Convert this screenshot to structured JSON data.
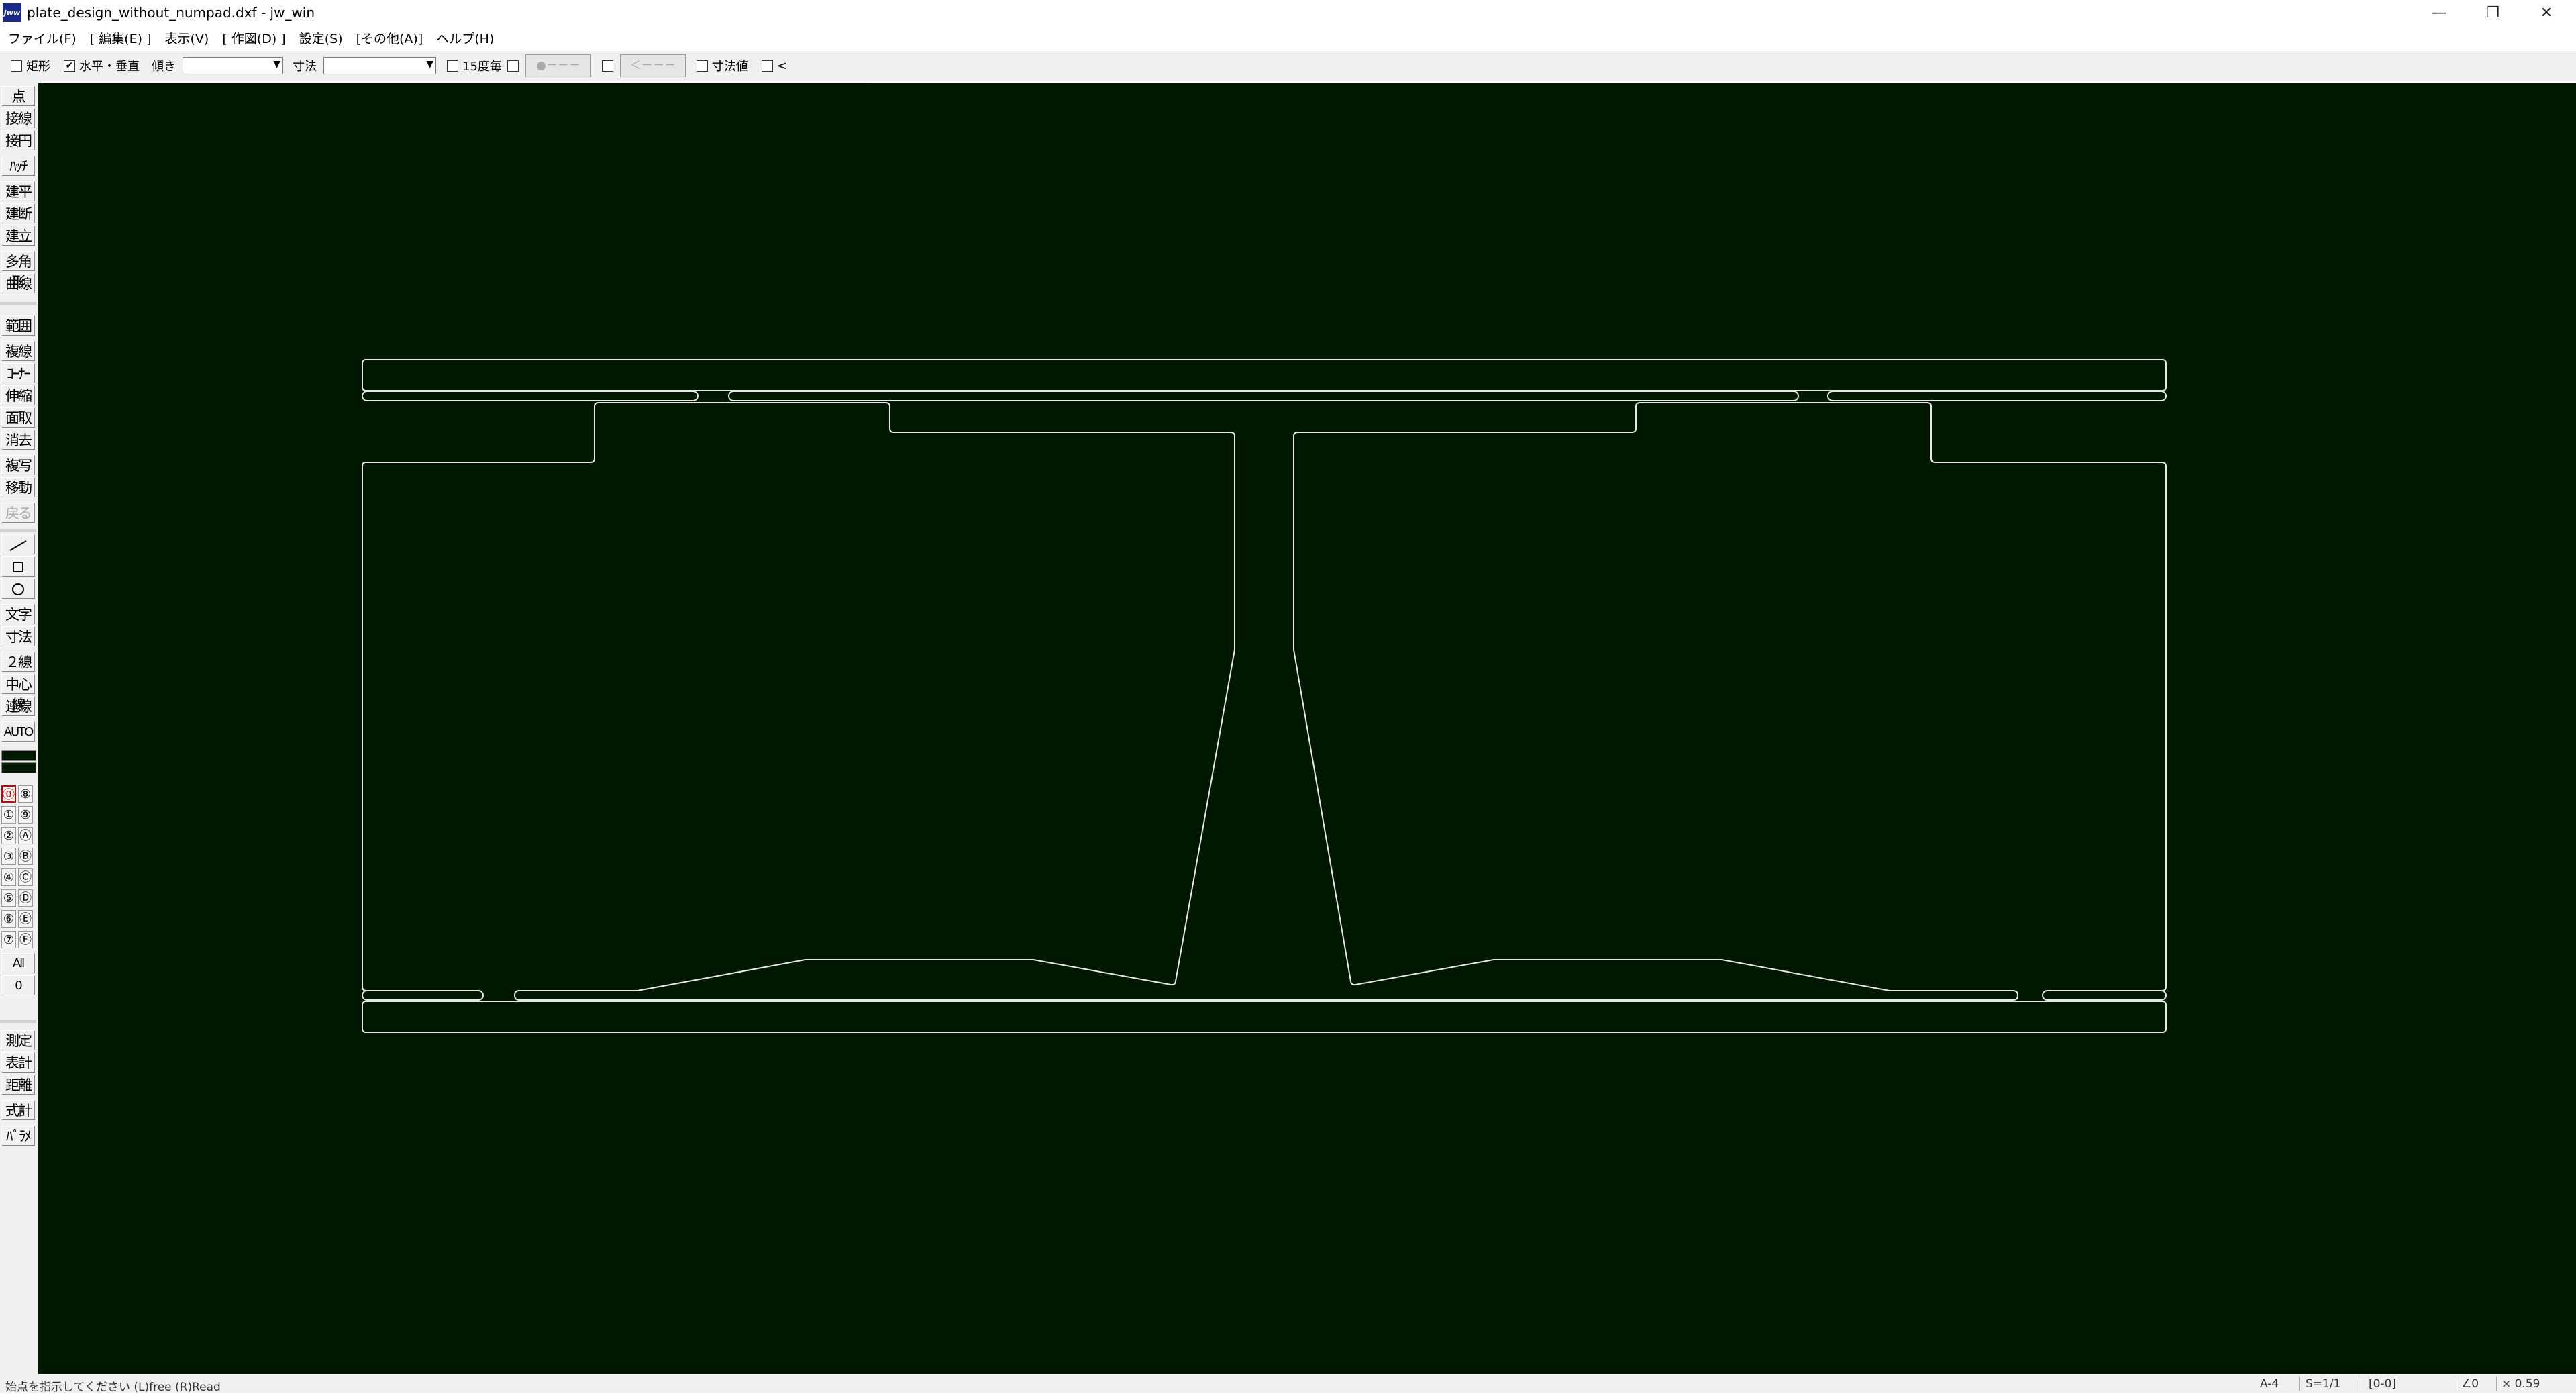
{
  "window": {
    "icon_text": "Jww",
    "title": "plate_design_without_numpad.dxf - jw_win",
    "minimize_label": "—",
    "restore_label": "❐",
    "close_label": "✕"
  },
  "menu": {
    "items": [
      "ファイル(F)",
      "[ 編集(E) ]",
      "表示(V)",
      "[ 作図(D) ]",
      "設定(S)",
      "[その他(A)]",
      "ヘルプ(H)"
    ]
  },
  "options": {
    "rect_label": "矩形",
    "rect_checked": false,
    "hv_label": "水平・垂直",
    "hv_checked": true,
    "tilt_label": "傾き",
    "tilt_value": "",
    "dim_label": "寸法",
    "dim_value": "",
    "deg15_label": "15度毎",
    "deg15_checked": false,
    "btn_dot_label": "●－－－",
    "btn_arrow_label": "＜－－－",
    "dimval_label": "寸法値",
    "dimval_checked": false,
    "lt_label": "<"
  },
  "toolbar": {
    "draw_group1": [
      "点",
      "接線",
      "接円",
      "ﾊｯﾁ",
      "建平",
      "建断",
      "建立",
      "多角形",
      "曲線"
    ],
    "edit_group": [
      "範囲",
      "複線",
      "ｺｰﾅｰ",
      "伸縮",
      "面取",
      "消去",
      "複写",
      "移動",
      "戻る"
    ],
    "draw_group2_shapes": [
      "line-icon",
      "rectangle-icon",
      "circle-icon"
    ],
    "draw_group2_text": [
      "文字",
      "寸法",
      "２線",
      "中心線",
      "連線",
      "AUTO"
    ],
    "layer_left": [
      "⓪",
      "①",
      "②",
      "③",
      "④",
      "⑤",
      "⑥",
      "⑦"
    ],
    "layer_right": [
      "⑧",
      "⑨",
      "Ⓐ",
      "Ⓑ",
      "Ⓒ",
      "Ⓓ",
      "Ⓔ",
      "Ⓕ"
    ],
    "layer_all": "All",
    "layer_zero": "0",
    "measure_group": [
      "測定",
      "表計",
      "距離",
      "式計",
      "ﾊﾟﾗﾒ"
    ]
  },
  "colors": {
    "canvas_bg": "#001800",
    "line": "#e8e8e8",
    "active_layer": "#d00000"
  },
  "status": {
    "message": "始点を指示してください (L)free (R)Read",
    "paper": "A-4",
    "scale": "S=1/1",
    "layer": "[0-0]",
    "angle": "∠0",
    "zoom": "× 0.59"
  }
}
